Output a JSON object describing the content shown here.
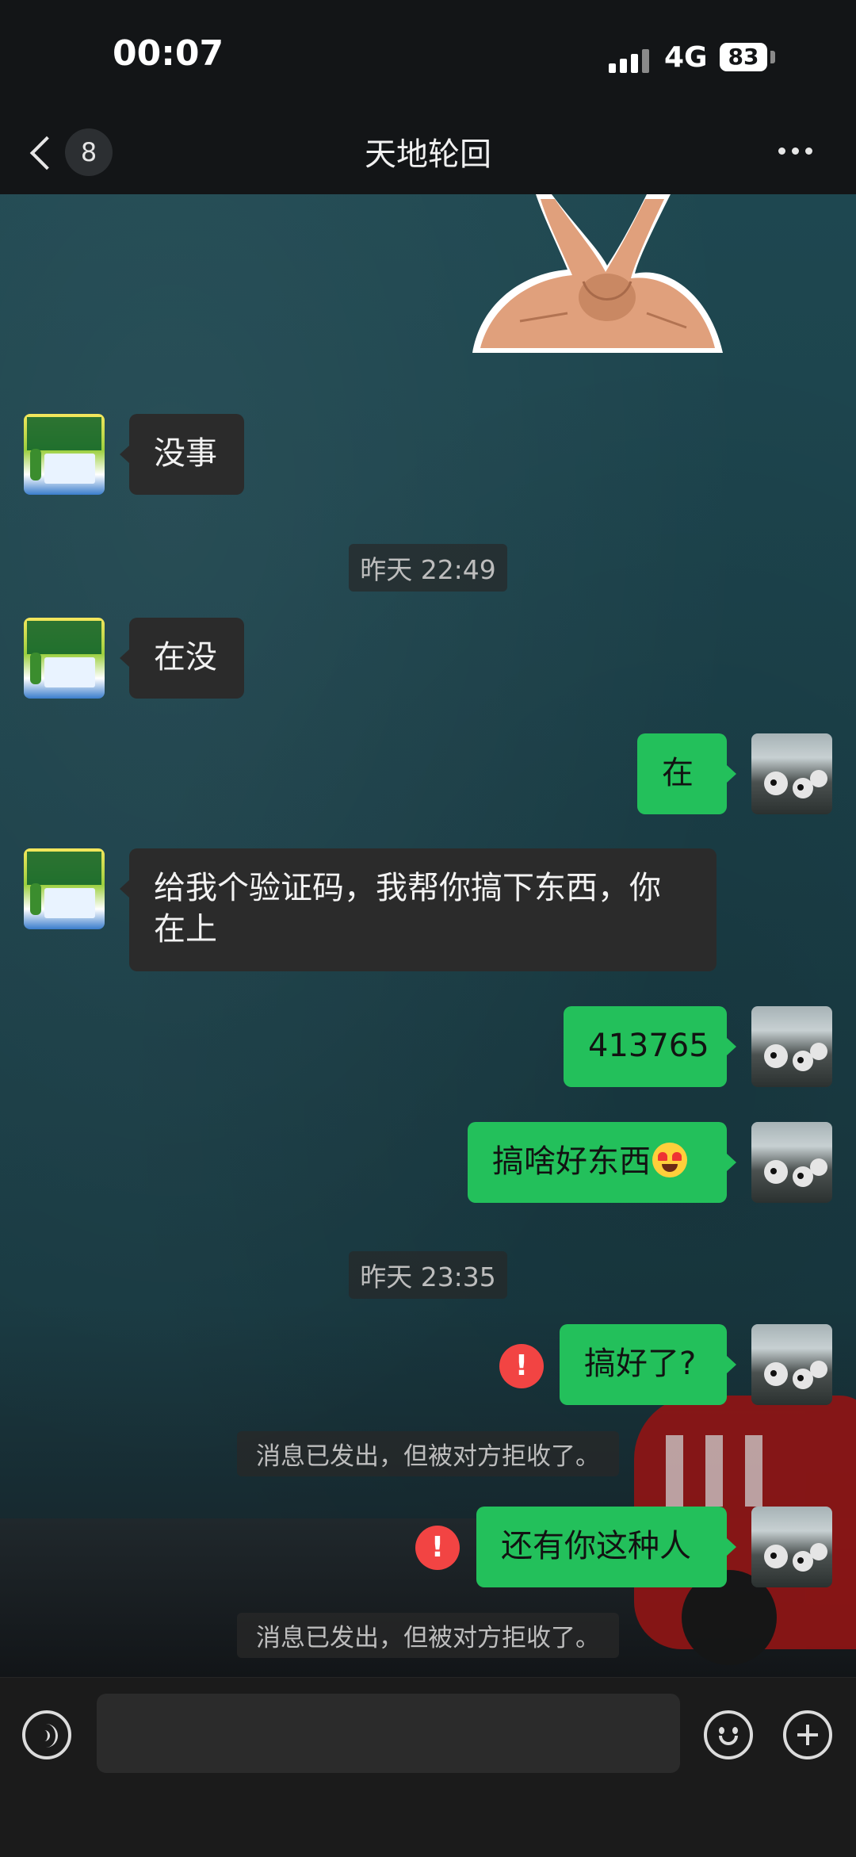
{
  "status_bar": {
    "time": "00:07",
    "network": "4G",
    "battery": "83"
  },
  "header": {
    "back_count": "8",
    "title": "天地轮回"
  },
  "messages": {
    "m1": "没事",
    "ts1": "昨天 22:49",
    "m2": "在没",
    "m3": "在",
    "m4": "给我个验证码，我帮你搞下东西，你在上",
    "m5": "413765",
    "m6": "搞啥好东西",
    "ts2": "昨天 23:35",
    "m7": "搞好了?",
    "note1": "消息已发出，但被对方拒收了。",
    "m8": "还有你这种人",
    "note2": "消息已发出，但被对方拒收了。",
    "error_mark": "!"
  },
  "input": {
    "value": "",
    "placeholder": ""
  },
  "icons": {
    "back": "chevron-left-icon",
    "more": "more-dots-icon",
    "voice": "voice-icon",
    "emoji": "emoji-icon",
    "plus": "plus-icon",
    "error": "error-icon",
    "emoji_inline": "heart-eyes-emoji"
  },
  "colors": {
    "bubble_sent": "#23c05b",
    "bubble_received": "#2b2b2b",
    "error": "#f24443",
    "header_bg": "#131517"
  }
}
